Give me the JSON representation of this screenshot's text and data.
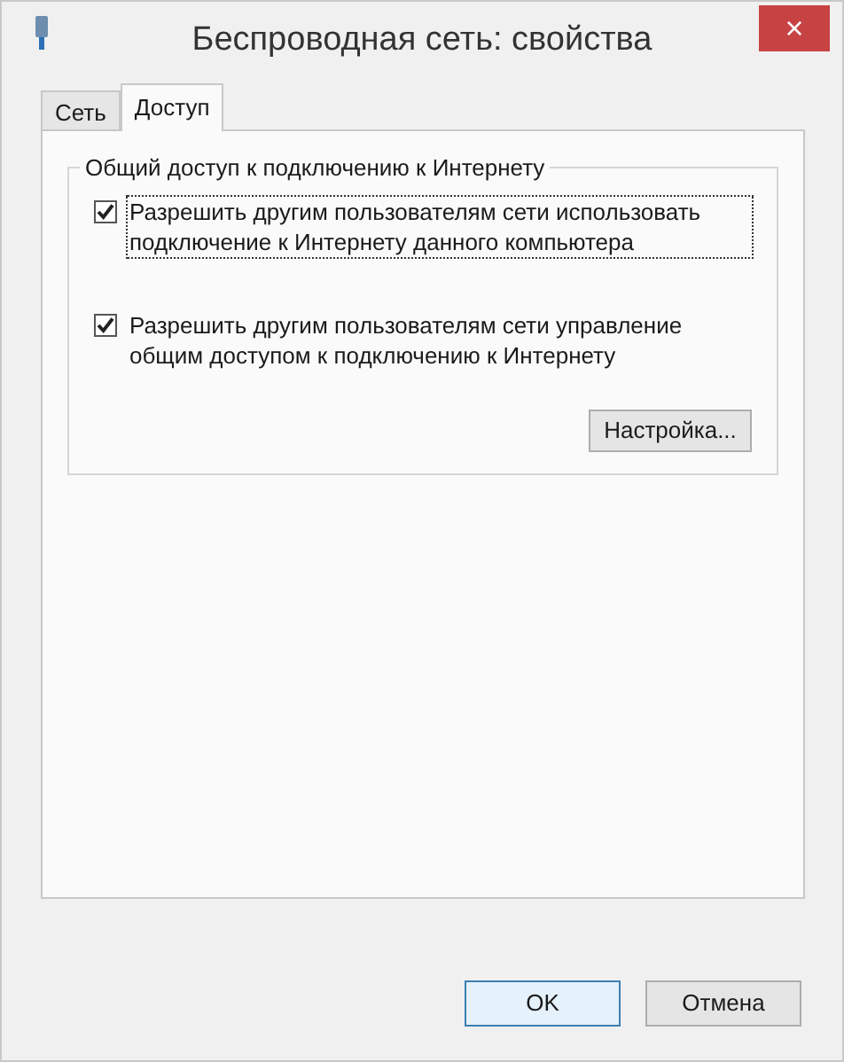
{
  "window": {
    "title": "Беспроводная сеть: свойства",
    "close": "×"
  },
  "tabs": [
    {
      "label": "Сеть",
      "selected": false
    },
    {
      "label": "Доступ",
      "selected": true
    }
  ],
  "group": {
    "title": "Общий доступ к подключению к Интернету",
    "checkboxes": [
      {
        "label": "Разрешить другим пользователям сети использовать подключение к Интернету данного компьютера",
        "checked": true,
        "focused": true
      },
      {
        "label": "Разрешить другим пользователям сети управление общим доступом к подключению к Интернету",
        "checked": true,
        "focused": false
      }
    ],
    "button": "Настройка..."
  },
  "buttons": [
    {
      "label": "OK",
      "default": true
    },
    {
      "label": "Отмена",
      "default": false
    }
  ]
}
